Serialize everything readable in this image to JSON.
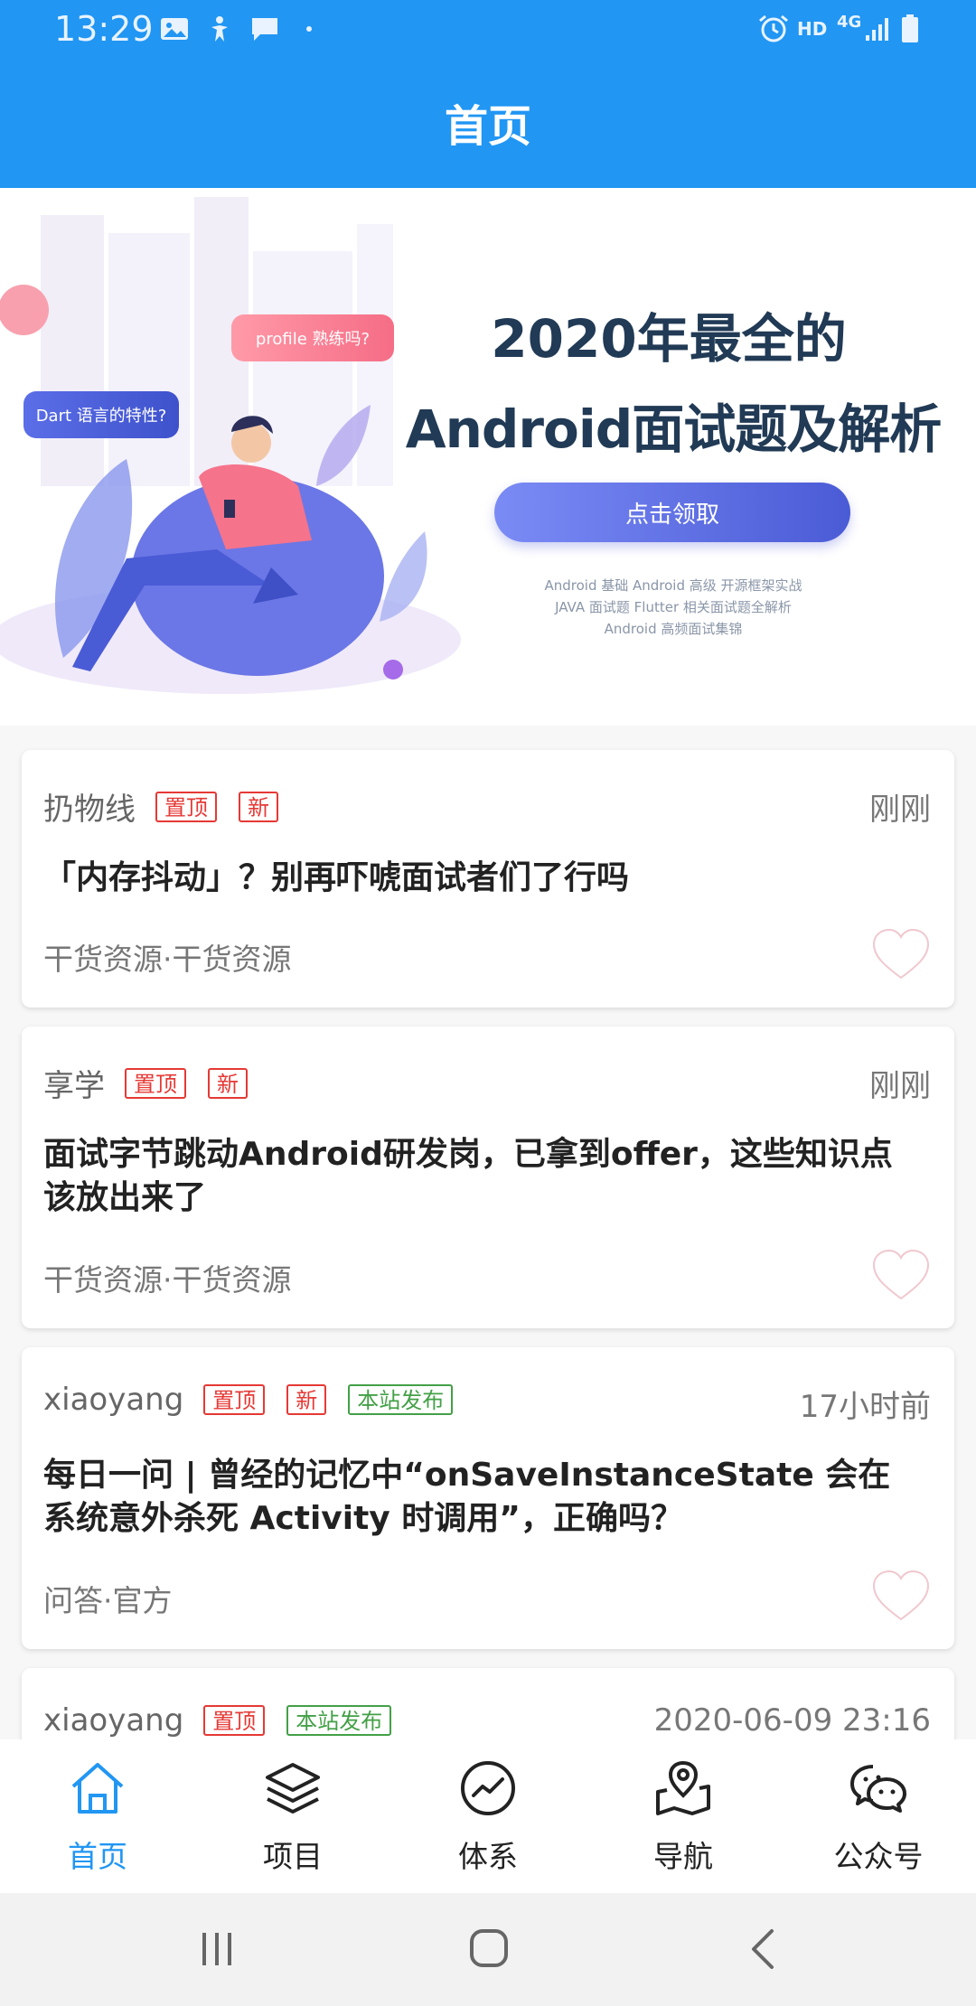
{
  "status": {
    "time": "13:29",
    "hd": "HD",
    "network": "4G"
  },
  "header": {
    "title": "首页"
  },
  "banner": {
    "headline1": "2020年最全的",
    "headline2": "Android面试题及解析",
    "button": "点击领取",
    "tags_line1": "Android 基础   Android 高级   开源框架实战",
    "tags_line2": "JAVA 面试题   Flutter 相关面试题全解析",
    "tags_line3": "Android 高频面试集锦",
    "bubble_dart": "Dart 语言的特性?",
    "bubble_profile": "profile 熟练吗?"
  },
  "articles": [
    {
      "author": "扔物线",
      "tags": [
        "置顶",
        "新"
      ],
      "time": "刚刚",
      "title": "「内存抖动」？别再吓唬面试者们了行吗",
      "chapter": "干货资源·干货资源"
    },
    {
      "author": "享学",
      "tags": [
        "置顶",
        "新"
      ],
      "time": "刚刚",
      "title": "面试字节跳动Android研发岗，已拿到offer，这些知识点该放出来了",
      "chapter": "干货资源·干货资源"
    },
    {
      "author": "xiaoyang",
      "tags": [
        "置顶",
        "新",
        "本站发布"
      ],
      "time": "17小时前",
      "title": "每日一问 | 曾经的记忆中“onSaveInstanceState 会在系统意外杀死 Activity 时调用”，正确吗？",
      "chapter": "问答·官方"
    },
    {
      "author": "xiaoyang",
      "tags": [
        "置顶",
        "本站发布"
      ],
      "time": "2020-06-09 23:16"
    }
  ],
  "bottom_nav": [
    {
      "label": "首页",
      "icon": "home-icon",
      "active": true
    },
    {
      "label": "项目",
      "icon": "layers-icon",
      "active": false
    },
    {
      "label": "体系",
      "icon": "trend-circle-icon",
      "active": false
    },
    {
      "label": "导航",
      "icon": "map-pin-icon",
      "active": false
    },
    {
      "label": "公众号",
      "icon": "wechat-icon",
      "active": false
    }
  ],
  "colors": {
    "primary": "#2196f3",
    "tag_red": "#e53935",
    "tag_green": "#43a047"
  }
}
